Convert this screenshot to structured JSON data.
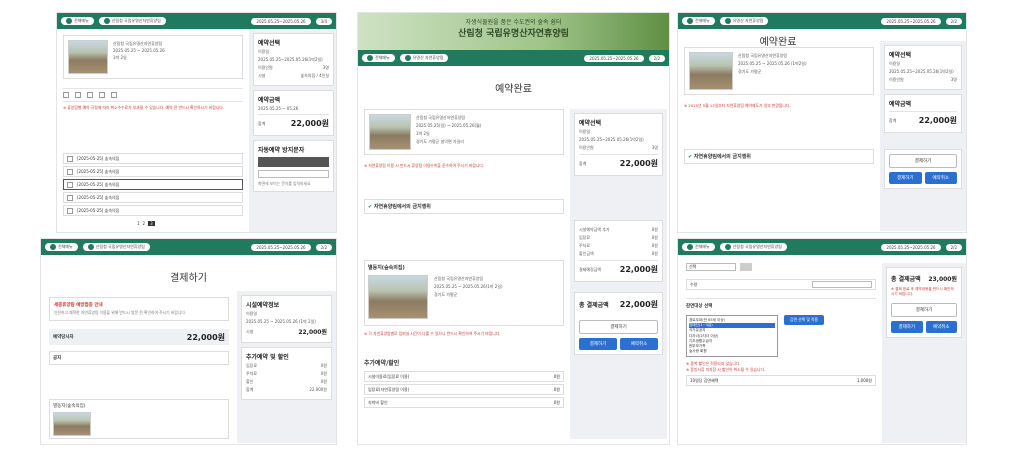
{
  "brand_color": "#1f7a5e",
  "p1": {
    "topbar": {
      "menu": "전체메뉴",
      "forest": "산림청 국립유명산자연휴양림",
      "dates": "2025.05.25~2025.05.26",
      "step": "3/4"
    },
    "info": {
      "l1": "산림청 국립유명산자연휴양림",
      "l2": "2025.05.25 ~ 2025.05.26",
      "l3": "1박 2일"
    },
    "side": {
      "title": "예약선택",
      "r1a": "이용일",
      "r1b": "2025.05.25~2025.05.26(1박2일)",
      "r2a": "이용인원",
      "r2b": "3명",
      "r3a": "시설",
      "r3b": "숲속의집 / 4인실",
      "sum_title": "예약금액",
      "sum_a": "2025.05.25 ~ 05.26",
      "sum_b": "22,000원",
      "total_a": "합계",
      "total_b": "22,000원"
    },
    "notice": "※ 휴양림별 예약 규정에 따라 취소수수료가 부과될 수 있습니다. 예약 전 반드시 확인하시기 바랍니다.",
    "rows": [
      "[2025-05-25] 숲속의집",
      "[2025-05-25] 숲속의집",
      "[2025-05-25] 숲속의집",
      "[2025-05-25] 숲속의집",
      "[2025-05-25] 숲속의집",
      "[2025-05-25] 숲속의집"
    ],
    "pages": [
      "1",
      "2",
      "3"
    ],
    "auth": {
      "title": "자동예약 방지문자",
      "desc": "화면에 보이는 문자를 입력하세요",
      "check": "예약 내용을 확인하였습니다"
    }
  },
  "p2": {
    "banner_sub": "자생식물원을 품은 수도권의 숲속 쉼터",
    "banner_main": "산림청 국립유명산자연휴양림",
    "topbar": {
      "menu": "전체메뉴",
      "forest": "유명산 자연휴양림",
      "dates": "2025.05.25~2025.05.26",
      "step": "2/2"
    },
    "title": "예약완료",
    "info": {
      "l1": "산림청 국립유명산자연휴양림",
      "l2": "2025.05.25(일) ~ 2025.05.26(월)",
      "l3": "1박 2일",
      "l4": "경기도 가평군 설악면 가일리"
    },
    "side": {
      "title": "예약선택",
      "r1a": "이용일",
      "r1b": "2025.05.25~2025.05.26(1박2일)",
      "r2a": "이용인원",
      "r2b": "3명",
      "total_a": "합계",
      "total_b": "22,000원"
    },
    "warn": "※ 자연휴양림 이용 시 반드시 휴양림 이용수칙을 준수하여 주시기 바랍니다.",
    "accordion": "자연휴양림에서의 금지행위",
    "item_title": "별둥지(숲속의집)",
    "item_info": {
      "l1": "산림청 국립유명산자연휴양림",
      "l2": "2025.05.25 ~ 2025.05.26(1박 2일)",
      "l3": "경기도 가평군"
    },
    "side2": {
      "r1a": "시설예약금액 추가",
      "r1b": "0원",
      "r2a": "입장료",
      "r2b": "0원",
      "r3a": "주차료",
      "r3b": "0원",
      "r4a": "할인금액",
      "r4b": "0원",
      "total_a": "결제예정금액",
      "total_b": "22,000원"
    },
    "warn2": "※ 각 자연휴양림별로 입퇴실 시간이 다를 수 있으니 반드시 확인하여 주시기 바랍니다.",
    "extra_title": "추가예약/할인",
    "extra_rows": [
      "시설이용료(입장료 이용)",
      "입장료(자연휴양림 이용)",
      "숙박비 할인"
    ],
    "extra_vals": [
      "0원",
      "0원",
      "0원"
    ],
    "pay_title": "총 결제금액",
    "pay_amount": "22,000원",
    "pay_btn": "결제하기",
    "btn_a": "결제하기",
    "btn_b": "예약취소"
  },
  "p3": {
    "topbar": {
      "menu": "전체메뉴",
      "forest": "유명산 자연휴양림",
      "dates": "2025.05.25~2025.05.26",
      "step": "2/2"
    },
    "title": "예약완료",
    "info": {
      "l1": "산림청 국립유명산자연휴양림",
      "l2": "2025.05.25 ~ 2025.05.26 (1박2일)",
      "l3": "경기도 가평군"
    },
    "side": {
      "title": "예약선택",
      "r1a": "이용일",
      "r1b": "2025.05.25~2025.05.26(1박2일)",
      "r2a": "이용인원",
      "r2b": "3명",
      "sum_title": "예약금액",
      "total_a": "합계",
      "total_b": "22,000원"
    },
    "warn": "※ 2025년 5월 13일부터 자연휴양림 예약제도가 일부 변경됩니다.",
    "accordion": "자연휴양림에서의 금지행위",
    "pay_btn": "결제하기",
    "btn_a": "결제하기",
    "btn_b": "예약취소"
  },
  "p4": {
    "topbar": {
      "menu": "전체메뉴",
      "forest": "산림청 국립유명산자연휴양림",
      "dates": "2025.05.25~2025.05.26",
      "step": "2/2"
    },
    "title": "결제하기",
    "notice_title": "세종휴양림 예방접종 안내",
    "notice_body": "안전하고 쾌적한 자연휴양림 이용을 위해 반드시 방문 전 확인하여 주시기 바랍니다.",
    "mini_label": "예약당사자",
    "mini_total": "22,000원",
    "notice2": "공지",
    "item": "별둥지(숲속의집)",
    "side": {
      "title": "시설예약정보",
      "r1a": "이용일",
      "r1b": "2025.05.25 ~ 2025.05.26 (1박 2일)",
      "r2a": "시설",
      "r2b": "22,000원",
      "extra": "추가예약 및 할인",
      "rows": [
        "입장료",
        "주차료",
        "할인",
        "합계"
      ],
      "vals": [
        "0원",
        "0원",
        "0원",
        "22,000원"
      ]
    }
  },
  "p5": {
    "topbar": {
      "menu": "전체메뉴",
      "forest": "산림청 국립유명산자연휴양림",
      "dates": "2025.05.25~2025.05.26",
      "step": "2/2"
    },
    "select_label": "선택",
    "qty_label": "수량",
    "discount_title": "감면대상 선택",
    "options": [
      "경로우대(만 65세 이상)",
      "장애인(1~3급)",
      "국가유공자",
      "다자녀(2자녀 이상)",
      "기초생활수급자",
      "한부모가족",
      "숲사랑 회원"
    ],
    "select_btn": "감면 선택 및 적용",
    "note1": "※ 중복 할인은 적용되지 않습니다.",
    "note2": "※ 증빙서류 미지참 시 할인이 취소될 수 있습니다.",
    "dc_row": "10명당 감면혜택",
    "dc_val": "1,000원",
    "side": {
      "title": "총 결제금액",
      "amount": "23,000원",
      "warn": "※ 결제 완료 후 예약내용을 반드시 확인하시기 바랍니다.",
      "btn": "결제하기",
      "btn_a": "결제하기",
      "btn_b": "예약취소"
    }
  }
}
